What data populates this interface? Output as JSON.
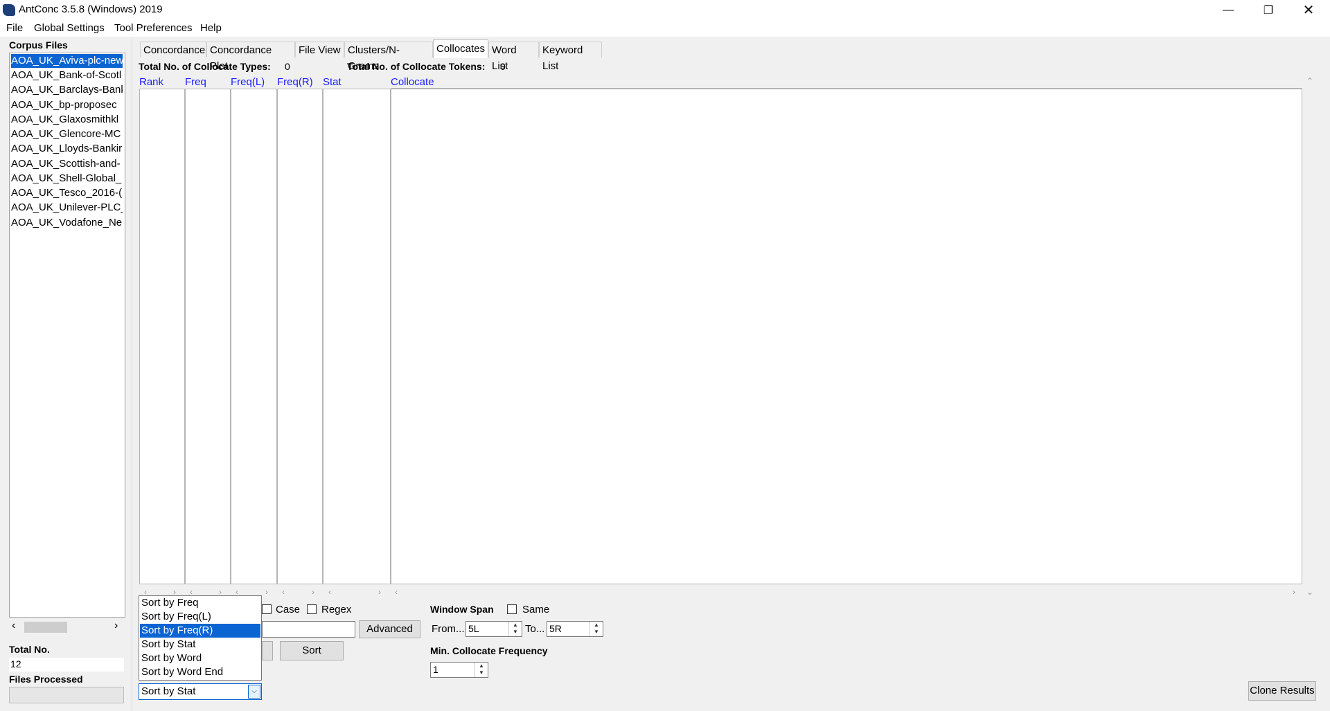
{
  "window": {
    "title": "AntConc 3.5.8 (Windows) 2019"
  },
  "menu": [
    "File",
    "Global Settings",
    "Tool Preferences",
    "Help"
  ],
  "sidebar": {
    "corpus_label": "Corpus Files",
    "files": [
      "AOA_UK_Aviva-plc-new",
      "AOA_UK_Bank-of-Scotl",
      "AOA_UK_Barclays-Bank",
      "AOA_UK_bp-proposec",
      "AOA_UK_Glaxosmithkl",
      "AOA_UK_Glencore-MC",
      "AOA_UK_Lloyds-Bankir",
      "AOA_UK_Scottish-and-",
      "AOA_UK_Shell-Global_",
      "AOA_UK_Tesco_2016-(",
      "AOA_UK_Unilever-PLC_",
      "AOA_UK_Vodafone_Ne"
    ],
    "total_label": "Total No.",
    "total_value": "12",
    "processed_label": "Files Processed"
  },
  "tabs": [
    "Concordance",
    "Concordance Plot",
    "File View",
    "Clusters/N-Grams",
    "Collocates",
    "Word List",
    "Keyword List"
  ],
  "active_tab": "Collocates",
  "summary": {
    "types_label": "Total No. of Collocate Types:",
    "types_value": "0",
    "tokens_label": "Total No. of Collocate Tokens:",
    "tokens_value": "0"
  },
  "columns": [
    "Rank",
    "Freq",
    "Freq(L)",
    "Freq(R)",
    "Stat",
    "Collocate"
  ],
  "search": {
    "case_label": "Case",
    "regex_label": "Regex",
    "advanced_label": "Advanced",
    "sort_label": "Sort"
  },
  "window_span": {
    "label": "Window Span",
    "same_label": "Same",
    "from_label": "From...",
    "from_value": "5L",
    "to_label": "To...",
    "to_value": "5R"
  },
  "min_freq": {
    "label": "Min. Collocate Frequency",
    "value": "1"
  },
  "sort_dropdown": {
    "options": [
      "Sort by Freq",
      "Sort by Freq(L)",
      "Sort by Freq(R)",
      "Sort by Stat",
      "Sort by Word",
      "Sort by Word End"
    ],
    "highlighted": "Sort by Freq(R)",
    "selected": "Sort by Stat"
  },
  "clone_label": "Clone Results",
  "icons": [
    "app-icon",
    "minimize-icon",
    "restore-icon",
    "close-icon",
    "scroll-left-icon",
    "scroll-right-icon",
    "scroll-up-icon",
    "scroll-down-icon",
    "spin-up-icon",
    "spin-down-icon",
    "dropdown-arrow-icon"
  ]
}
